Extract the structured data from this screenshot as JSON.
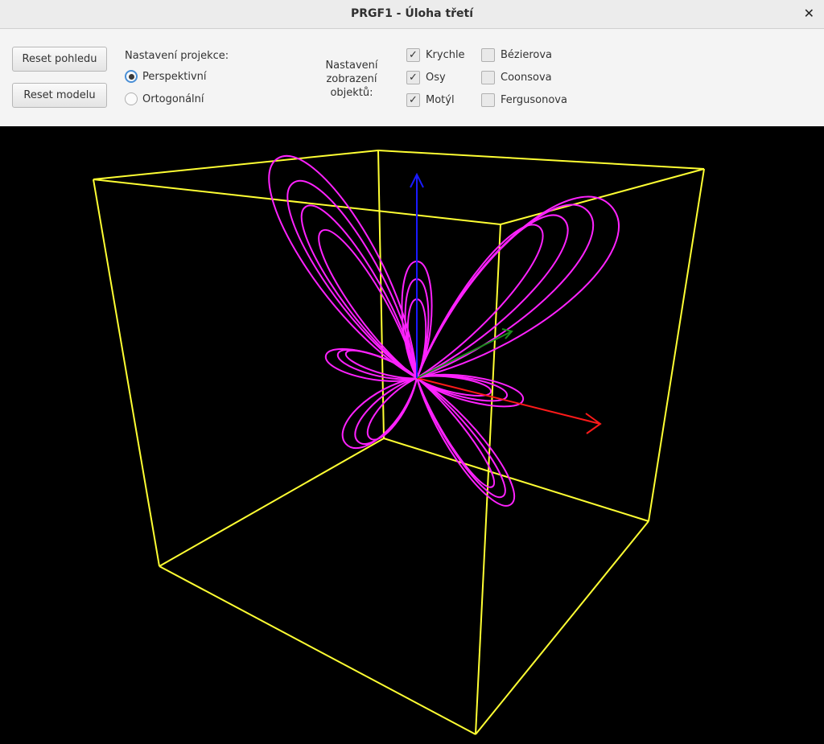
{
  "window": {
    "title": "PRGF1 - Úloha třetí",
    "close_glyph": "✕"
  },
  "toolbar": {
    "reset_view_label": "Reset pohledu",
    "reset_model_label": "Reset modelu",
    "projection_label": "Nastavení projekce:",
    "projection_options": [
      {
        "label": "Perspektivní",
        "selected": true
      },
      {
        "label": "Ortogonální",
        "selected": false
      }
    ],
    "display_label_lines": [
      "Nastavení",
      "zobrazení",
      "objektů:"
    ],
    "objects": [
      {
        "label": "Krychle",
        "checked": true
      },
      {
        "label": "Osy",
        "checked": true
      },
      {
        "label": "Motýl",
        "checked": true
      },
      {
        "label": "Bézierova",
        "checked": false
      },
      {
        "label": "Coonsova",
        "checked": false
      },
      {
        "label": "Fergusonova",
        "checked": false
      }
    ],
    "check_glyph": "✓"
  },
  "scene": {
    "colors": {
      "background": "#000000",
      "cube": "#ffff33",
      "butterfly": "#ff22ff",
      "axis_x": "#ff1a1a",
      "axis_y": "#1a8f1a",
      "axis_z": "#1a1aff"
    }
  }
}
